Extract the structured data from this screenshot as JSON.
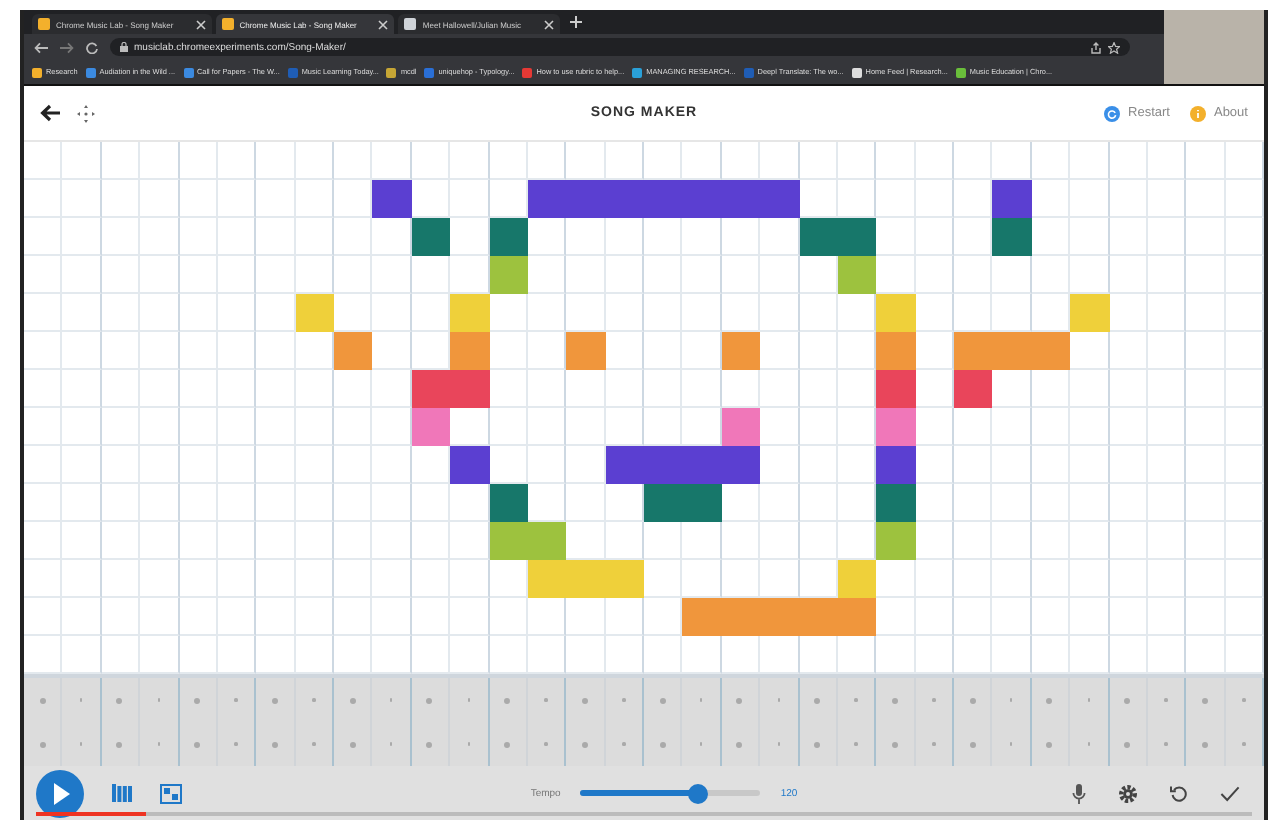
{
  "browser": {
    "tabs": [
      {
        "title": "Chrome Music Lab - Song Maker",
        "selected": false
      },
      {
        "title": "Chrome Music Lab - Song Maker",
        "selected": true
      },
      {
        "title": "Meet Hallowell/Julian Music",
        "selected": false
      }
    ],
    "url": "musiclab.chromeexperiments.com/Song-Maker/",
    "bookmarks": [
      "Research",
      "Audiation in the Wild ...",
      "Call for Papers - The W...",
      "Music Learning Today...",
      "mcdl",
      "uniquehop - Typology...",
      "How to use rubric to help...",
      "MANAGING RESEARCH...",
      "Deepl Translate: The wo...",
      "Home Feed | Research...",
      "Music Education | Chro..."
    ]
  },
  "header": {
    "title": "SONG MAKER",
    "links": [
      "Restart",
      "About"
    ]
  },
  "melody": {
    "rows": [
      {
        "cells": [
          false,
          false,
          false,
          false,
          false,
          false,
          false,
          false,
          false,
          false,
          false,
          false,
          false,
          false,
          false,
          false,
          false,
          false,
          false,
          false,
          false,
          false,
          false,
          false,
          false,
          false,
          false,
          false,
          false,
          false,
          false,
          false
        ]
      },
      {
        "color": "#5b3fd1",
        "cells": [
          false,
          false,
          false,
          false,
          false,
          false,
          false,
          false,
          false,
          true,
          false,
          false,
          false,
          true,
          true,
          true,
          true,
          true,
          true,
          true,
          false,
          false,
          false,
          false,
          false,
          true,
          false,
          false,
          false,
          false,
          false,
          false
        ]
      },
      {
        "color": "#17776a",
        "cells": [
          false,
          false,
          false,
          false,
          false,
          false,
          false,
          false,
          false,
          false,
          true,
          false,
          true,
          false,
          false,
          false,
          false,
          false,
          false,
          false,
          true,
          true,
          false,
          false,
          false,
          true,
          false,
          false,
          false,
          false,
          false,
          false
        ]
      },
      {
        "color": "#9dc23e",
        "cells": [
          false,
          false,
          false,
          false,
          false,
          false,
          false,
          false,
          false,
          false,
          false,
          false,
          true,
          false,
          false,
          false,
          false,
          false,
          false,
          false,
          false,
          true,
          false,
          false,
          false,
          false,
          false,
          false,
          false,
          false,
          false,
          false
        ]
      },
      {
        "color": "#efd03a",
        "cells": [
          false,
          false,
          false,
          false,
          false,
          false,
          false,
          true,
          false,
          false,
          false,
          true,
          false,
          false,
          false,
          false,
          false,
          false,
          false,
          false,
          false,
          false,
          true,
          false,
          false,
          false,
          false,
          true,
          false,
          false,
          false,
          false
        ]
      },
      {
        "color": "#f0963c",
        "cells": [
          false,
          false,
          false,
          false,
          false,
          false,
          false,
          false,
          true,
          false,
          false,
          true,
          false,
          false,
          true,
          false,
          false,
          false,
          true,
          false,
          false,
          false,
          true,
          false,
          true,
          true,
          true,
          false,
          false,
          false,
          false,
          false
        ]
      },
      {
        "color": "#e9455b",
        "cells": [
          false,
          false,
          false,
          false,
          false,
          false,
          false,
          false,
          false,
          false,
          true,
          true,
          false,
          false,
          false,
          false,
          false,
          false,
          false,
          false,
          false,
          false,
          true,
          false,
          true,
          false,
          false,
          false,
          false,
          false,
          false,
          false
        ]
      },
      {
        "color": "#f077b9",
        "cells": [
          false,
          false,
          false,
          false,
          false,
          false,
          false,
          false,
          false,
          false,
          true,
          false,
          false,
          false,
          false,
          false,
          false,
          false,
          true,
          false,
          false,
          false,
          true,
          false,
          false,
          false,
          false,
          false,
          false,
          false,
          false,
          false
        ]
      },
      {
        "color": "#5b3fd1",
        "cells": [
          false,
          false,
          false,
          false,
          false,
          false,
          false,
          false,
          false,
          false,
          false,
          true,
          false,
          false,
          false,
          true,
          true,
          true,
          true,
          false,
          false,
          false,
          true,
          false,
          false,
          false,
          false,
          false,
          false,
          false,
          false,
          false
        ]
      },
      {
        "color": "#17776a",
        "cells": [
          false,
          false,
          false,
          false,
          false,
          false,
          false,
          false,
          false,
          false,
          false,
          false,
          true,
          false,
          false,
          false,
          true,
          true,
          false,
          false,
          false,
          false,
          true,
          false,
          false,
          false,
          false,
          false,
          false,
          false,
          false,
          false
        ]
      },
      {
        "color": "#9dc23e",
        "cells": [
          false,
          false,
          false,
          false,
          false,
          false,
          false,
          false,
          false,
          false,
          false,
          false,
          true,
          true,
          false,
          false,
          false,
          false,
          false,
          false,
          false,
          false,
          true,
          false,
          false,
          false,
          false,
          false,
          false,
          false,
          false,
          false
        ]
      },
      {
        "color": "#efd03a",
        "cells": [
          false,
          false,
          false,
          false,
          false,
          false,
          false,
          false,
          false,
          false,
          false,
          false,
          false,
          true,
          true,
          true,
          false,
          false,
          false,
          false,
          false,
          true,
          false,
          false,
          false,
          false,
          false,
          false,
          false,
          false,
          false,
          false
        ]
      },
      {
        "color": "#f0963c",
        "cells": [
          false,
          false,
          false,
          false,
          false,
          false,
          false,
          false,
          false,
          false,
          false,
          false,
          false,
          false,
          false,
          false,
          false,
          true,
          true,
          true,
          true,
          true,
          false,
          false,
          false,
          false,
          false,
          false,
          false,
          false,
          false,
          false
        ]
      },
      {
        "cells": [
          false,
          false,
          false,
          false,
          false,
          false,
          false,
          false,
          false,
          false,
          false,
          false,
          false,
          false,
          false,
          false,
          false,
          false,
          false,
          false,
          false,
          false,
          false,
          false,
          false,
          false,
          false,
          false,
          false,
          false,
          false,
          false
        ]
      }
    ]
  },
  "controls": {
    "tempo_label": "Tempo",
    "tempo": {
      "level": 0.65
    },
    "tempo_value": "120"
  },
  "video_progress": {
    "level": 0.09
  }
}
